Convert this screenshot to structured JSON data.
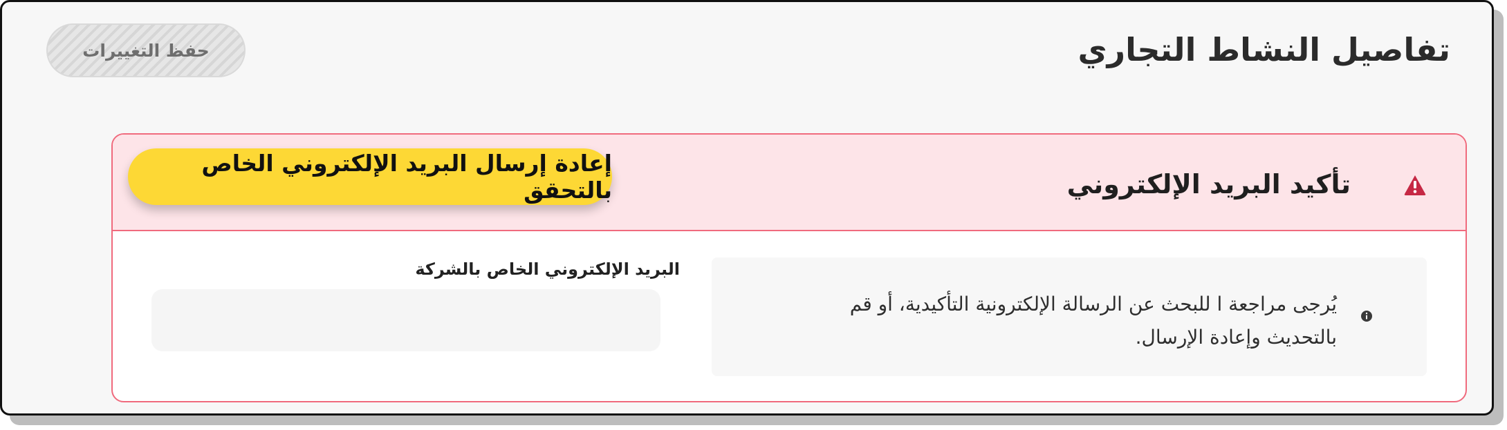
{
  "header": {
    "title": "تفاصيل النشاط التجاري",
    "save_label": "حفظ التغييرات"
  },
  "email_verification": {
    "title": "تأكيد البريد الإلكتروني",
    "resend_label": "إعادة إرسال البريد الإلكتروني الخاص بالتحقق",
    "info_text": "يُرجى مراجعة ا للبحث عن الرسالة الإلكترونية التأكيدية، أو قم بالتحديث وإعادة الإرسال.",
    "field_label": "البريد الإلكتروني الخاص بالشركة",
    "field_value": "",
    "field_placeholder": ""
  },
  "icons": {
    "alert": "warning-triangle-icon",
    "info": "info-circle-icon"
  },
  "colors": {
    "alert_red": "#c62844",
    "card_border": "#f06a7d",
    "header_bg": "#fde4e8",
    "resend_button": "#fdd835"
  }
}
